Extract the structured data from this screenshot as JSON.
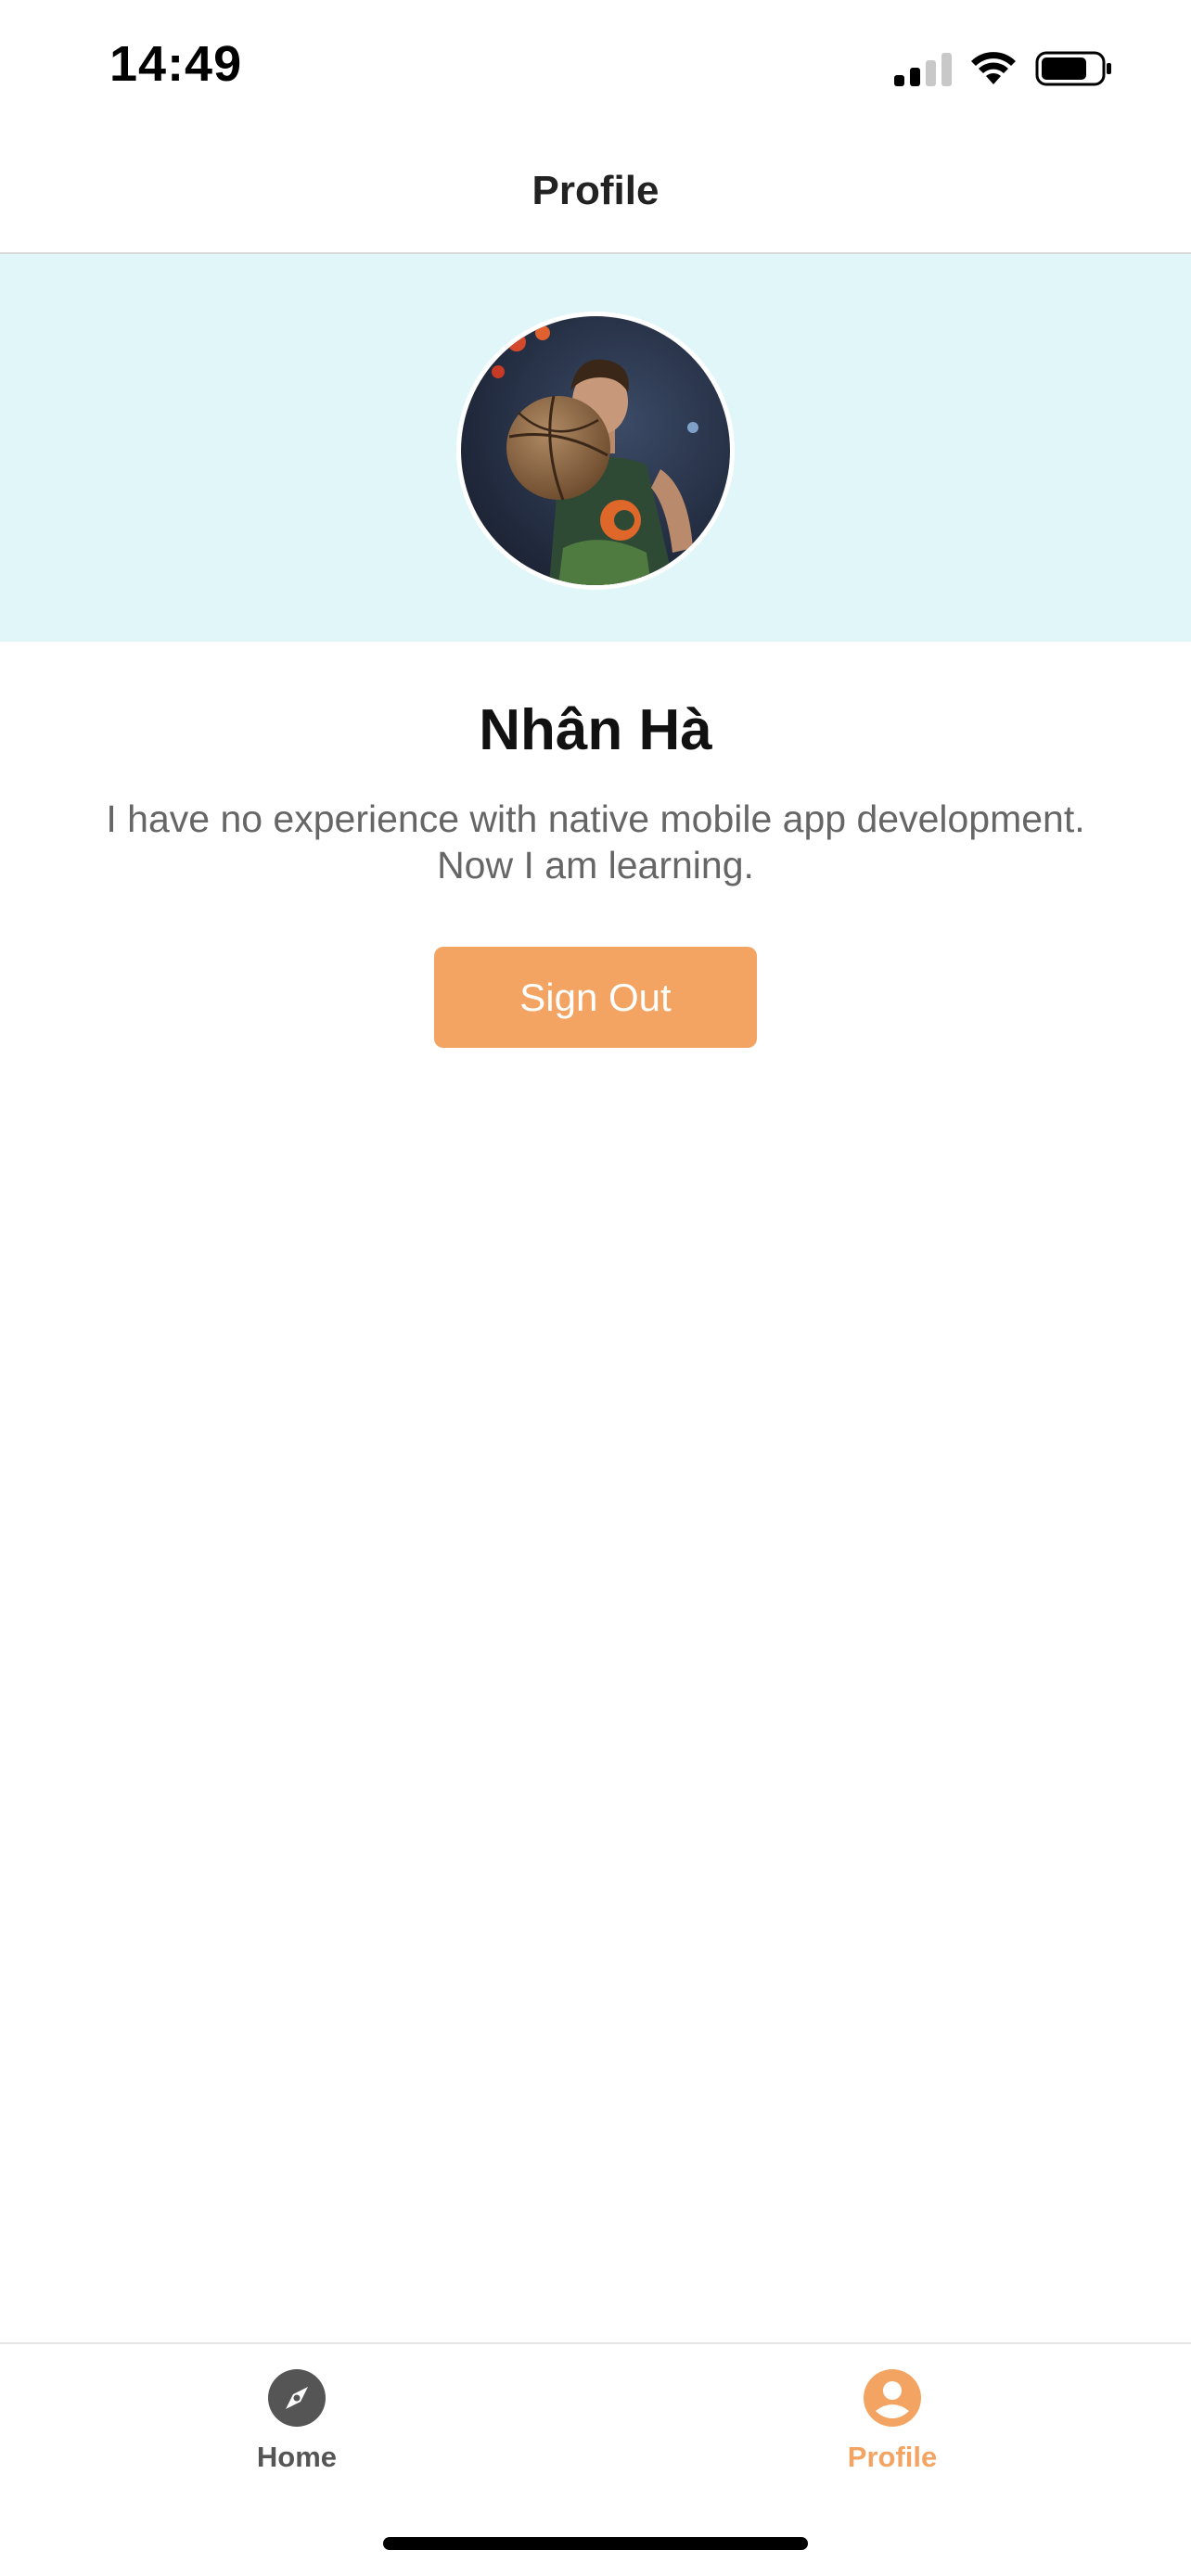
{
  "status_bar": {
    "time": "14:49"
  },
  "header": {
    "title": "Profile"
  },
  "profile": {
    "name": "Nhân Hà",
    "bio_line1": "I have no experience with native mobile app development.",
    "bio_line2": "Now I am learning.",
    "signout_label": "Sign Out"
  },
  "tab_bar": {
    "tabs": [
      {
        "label": "Home",
        "icon": "compass-icon",
        "active": false
      },
      {
        "label": "Profile",
        "icon": "user-circle-icon",
        "active": true
      }
    ]
  },
  "colors": {
    "accent": "#f4a462",
    "cover_background": "#e0f6f8",
    "inactive_tab": "#555555"
  }
}
